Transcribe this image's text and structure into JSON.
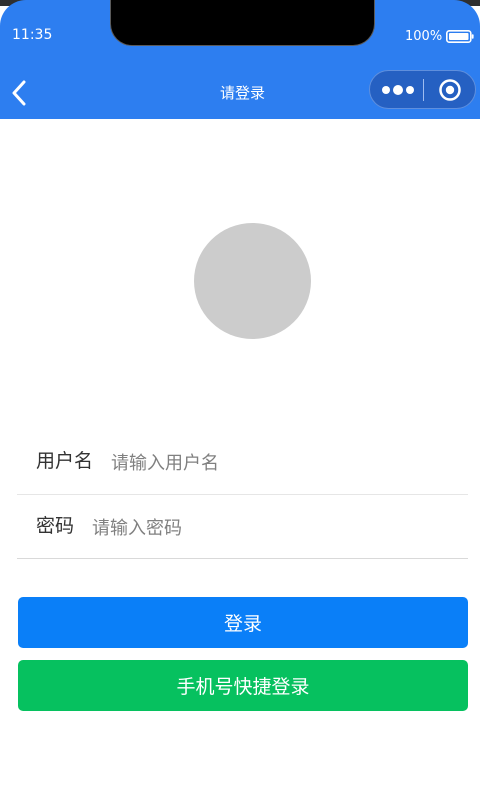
{
  "status_bar": {
    "time": "11:35",
    "battery": "100%"
  },
  "navigation": {
    "title": "请登录",
    "icons": [
      "chevron-left-icon",
      "more-dots-icon",
      "target-icon"
    ]
  },
  "avatar": {
    "icon": "avatar-placeholder"
  },
  "form": {
    "username": {
      "label": "用户名",
      "placeholder": "请输入用户名",
      "value": ""
    },
    "password": {
      "label": "密码",
      "placeholder": "请输入密码",
      "value": ""
    }
  },
  "buttons": {
    "login": "登录",
    "phone_login": "手机号快捷登录"
  },
  "colors": {
    "header": "#2d7ef0",
    "capsule": "#2560c2",
    "login_button": "#0a7ff8",
    "phone_button": "#06c15f",
    "avatar": "#cccccc"
  }
}
